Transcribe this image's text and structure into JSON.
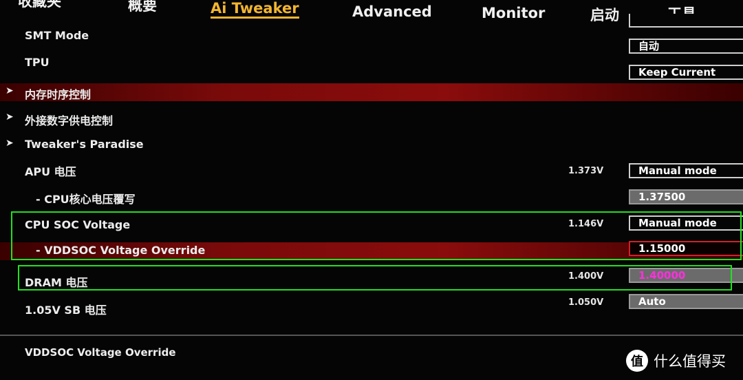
{
  "tabs": [
    {
      "label": "收藏夹"
    },
    {
      "label": "概要"
    },
    {
      "label": "Ai Tweaker",
      "active": true
    },
    {
      "label": "Advanced"
    },
    {
      "label": "Monitor"
    },
    {
      "label": "启动"
    },
    {
      "label": "工具"
    }
  ],
  "settings": [
    {
      "label": "SMT Mode",
      "value": ""
    },
    {
      "label": "TPU",
      "value": "自动"
    },
    {
      "label": "",
      "value": "Keep Current"
    },
    {
      "label": "内存时序控制",
      "submenu": true
    },
    {
      "label": "外接数字供电控制",
      "submenu": true
    },
    {
      "label": "Tweaker's Paradise",
      "submenu": true
    },
    {
      "label": "APU 电压",
      "reading": "1.373V",
      "value": "Manual mode"
    },
    {
      "label": "- CPU核心电压覆写",
      "value": "1.37500"
    },
    {
      "label": "CPU SOC Voltage",
      "reading": "1.146V",
      "value": "Manual mode"
    },
    {
      "label": "- VDDSOC Voltage Override",
      "value": "1.15000"
    },
    {
      "label": "DRAM 电压",
      "reading": "1.400V",
      "value": "1.40000"
    },
    {
      "label": "1.05V SB 电压",
      "reading": "1.050V",
      "value": "Auto"
    }
  ],
  "help_text": "VDDSOC Voltage Override",
  "watermark": {
    "logo": "值",
    "text": "什么值得买"
  },
  "colors": {
    "active_tab": "#f2b531",
    "highlight_box": "#22e022",
    "selected_row": "#8a0c0c",
    "edited_value": "#ff2ee0"
  }
}
